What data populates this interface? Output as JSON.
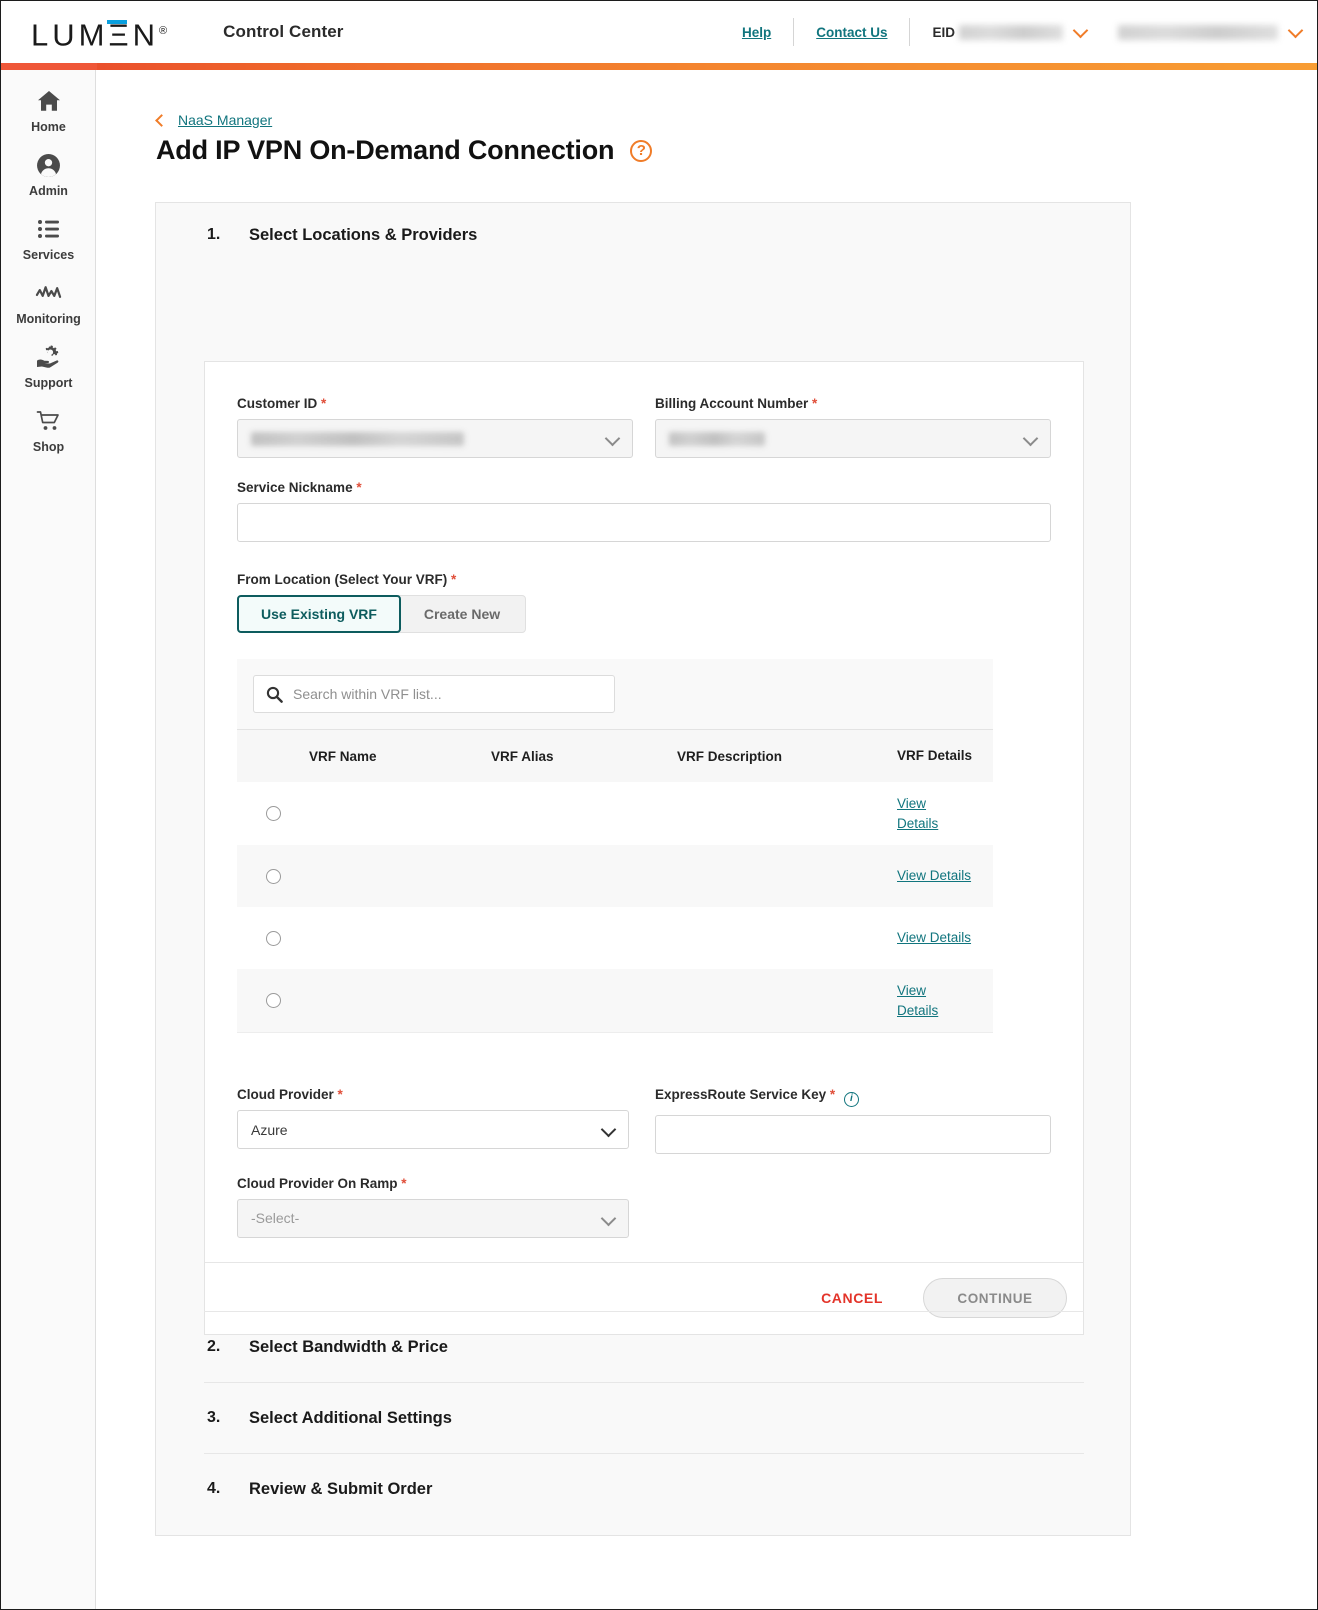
{
  "header": {
    "logo": "LUMΞN",
    "logo_registered": "®",
    "app_title": "Control Center",
    "help_label": "Help",
    "contact_label": "Contact Us",
    "eid_label": "EID",
    "eid_value_redacted": "",
    "account_value_redacted": ""
  },
  "sidebar": {
    "items": [
      {
        "label": "Home",
        "icon": "home-icon"
      },
      {
        "label": "Admin",
        "icon": "user-circle-icon"
      },
      {
        "label": "Services",
        "icon": "list-icon"
      },
      {
        "label": "Monitoring",
        "icon": "waveform-icon"
      },
      {
        "label": "Support",
        "icon": "gear-hand-icon"
      },
      {
        "label": "Shop",
        "icon": "cart-icon"
      }
    ]
  },
  "breadcrumb": {
    "label": "NaaS Manager"
  },
  "page": {
    "title": "Add IP VPN On-Demand Connection",
    "help_icon": "?"
  },
  "steps": [
    {
      "num": "1.",
      "title": "Select Locations & Providers"
    },
    {
      "num": "2.",
      "title": "Select Bandwidth & Price"
    },
    {
      "num": "3.",
      "title": "Select Additional Settings"
    },
    {
      "num": "4.",
      "title": "Review & Submit Order"
    }
  ],
  "form": {
    "customer_id": {
      "label": "Customer ID",
      "required": "*",
      "value": "",
      "redacted": true
    },
    "billing_account": {
      "label": "Billing Account Number",
      "required": "*",
      "value": "",
      "redacted": true
    },
    "service_nickname": {
      "label": "Service Nickname",
      "required": "*",
      "value": "",
      "placeholder": ""
    },
    "from_location": {
      "label": "From Location (Select Your VRF)",
      "required": "*",
      "toggle_selected": "Use Existing VRF",
      "toggle_options": [
        "Use Existing VRF",
        "Create New"
      ]
    },
    "cloud_provider": {
      "label": "Cloud Provider",
      "required": "*",
      "value": "Azure"
    },
    "express_route_key": {
      "label": "ExpressRoute Service Key",
      "required": "*",
      "value": "",
      "info_icon": "i"
    },
    "cloud_provider_on_ramp": {
      "label": "Cloud Provider On Ramp",
      "required": "*",
      "value": "-Select-"
    }
  },
  "vrf_table": {
    "search_placeholder": "Search within VRF list...",
    "search_value": "",
    "search_icon": "search-icon",
    "columns": [
      "VRF Name",
      "VRF Alias",
      "VRF Description",
      "VRF Details"
    ],
    "rows": [
      {
        "name": "",
        "alias": "",
        "description": "",
        "details_link": "View Details",
        "selected": false,
        "redacted": true
      },
      {
        "name": "",
        "alias": "",
        "description": "",
        "details_link": "View Details",
        "selected": false,
        "redacted": true
      },
      {
        "name": "",
        "alias": "",
        "description": "",
        "details_link": "View Details",
        "selected": false,
        "redacted": true
      },
      {
        "name": "",
        "alias": "",
        "description": "",
        "details_link": "View Details",
        "selected": false,
        "redacted": true
      }
    ]
  },
  "actions": {
    "cancel_label": "CANCEL",
    "continue_label": "CONTINUE",
    "continue_disabled": true
  },
  "colors": {
    "brand_teal": "#11757e",
    "brand_orange": "#f07c28",
    "gradient_start": "#e8442c",
    "gradient_end": "#f89d33",
    "cancel_red": "#e3342a",
    "toggle_active_border": "#0d5c5e",
    "logo_accent_blue": "#0aa0df"
  }
}
